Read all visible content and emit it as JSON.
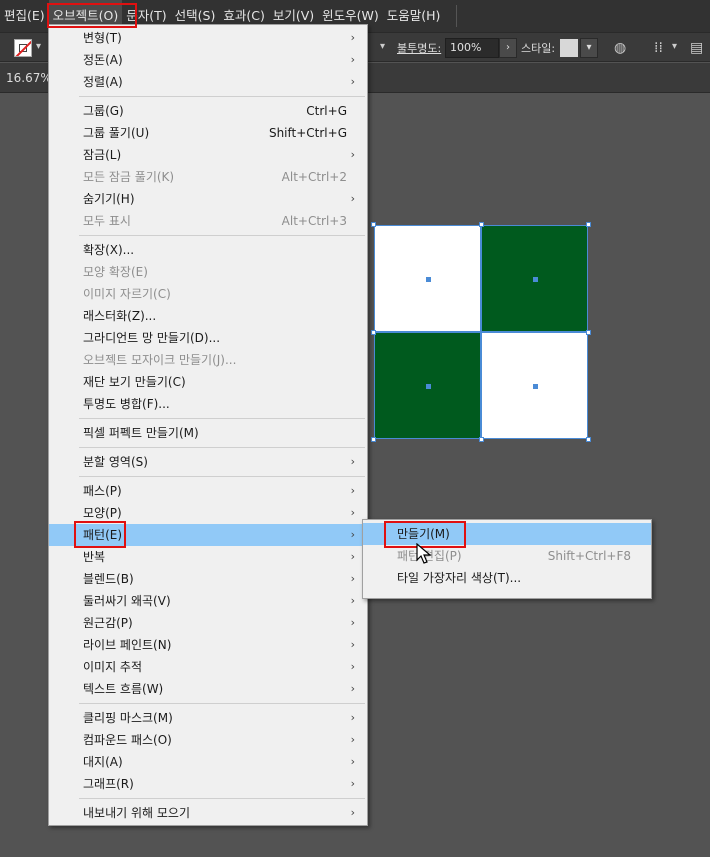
{
  "menubar": {
    "items": [
      "편집(E)",
      "오브젝트(O)",
      "문자(T)",
      "선택(S)",
      "효과(C)",
      "보기(V)",
      "윈도우(W)",
      "도움말(H)"
    ]
  },
  "toolbar": {
    "opacity_label": "불투명도:",
    "opacity_value": "100%",
    "style_label": "스타일:"
  },
  "document": {
    "zoom": "16.67%"
  },
  "colors": {
    "accent": "#91c9f7",
    "green": "#005a1e",
    "selection": "#4a8bd6",
    "highlight_red": "#e01010"
  },
  "object_menu": {
    "items": [
      {
        "label": "변형(T)",
        "shortcut": "",
        "submenu": true,
        "disabled": false
      },
      {
        "label": "정돈(A)",
        "shortcut": "",
        "submenu": true,
        "disabled": false
      },
      {
        "label": "정렬(A)",
        "shortcut": "",
        "submenu": true,
        "disabled": false
      },
      {
        "sep": true
      },
      {
        "label": "그룹(G)",
        "shortcut": "Ctrl+G",
        "submenu": false,
        "disabled": false
      },
      {
        "label": "그룹 풀기(U)",
        "shortcut": "Shift+Ctrl+G",
        "submenu": false,
        "disabled": false
      },
      {
        "label": "잠금(L)",
        "shortcut": "",
        "submenu": true,
        "disabled": false
      },
      {
        "label": "모든 잠금 풀기(K)",
        "shortcut": "Alt+Ctrl+2",
        "submenu": false,
        "disabled": true
      },
      {
        "label": "숨기기(H)",
        "shortcut": "",
        "submenu": true,
        "disabled": false
      },
      {
        "label": "모두 표시",
        "shortcut": "Alt+Ctrl+3",
        "submenu": false,
        "disabled": true
      },
      {
        "sep": true
      },
      {
        "label": "확장(X)...",
        "shortcut": "",
        "submenu": false,
        "disabled": false
      },
      {
        "label": "모양 확장(E)",
        "shortcut": "",
        "submenu": false,
        "disabled": true
      },
      {
        "label": "이미지 자르기(C)",
        "shortcut": "",
        "submenu": false,
        "disabled": true
      },
      {
        "label": "래스터화(Z)...",
        "shortcut": "",
        "submenu": false,
        "disabled": false
      },
      {
        "label": "그라디언트 망 만들기(D)...",
        "shortcut": "",
        "submenu": false,
        "disabled": false
      },
      {
        "label": "오브젝트 모자이크 만들기(J)...",
        "shortcut": "",
        "submenu": false,
        "disabled": true
      },
      {
        "label": "재단 보기 만들기(C)",
        "shortcut": "",
        "submenu": false,
        "disabled": false
      },
      {
        "label": "투명도 병합(F)...",
        "shortcut": "",
        "submenu": false,
        "disabled": false
      },
      {
        "sep": true
      },
      {
        "label": "픽셀 퍼펙트 만들기(M)",
        "shortcut": "",
        "submenu": false,
        "disabled": false
      },
      {
        "sep": true
      },
      {
        "label": "분할 영역(S)",
        "shortcut": "",
        "submenu": true,
        "disabled": false
      },
      {
        "sep": true
      },
      {
        "label": "패스(P)",
        "shortcut": "",
        "submenu": true,
        "disabled": false
      },
      {
        "label": "모양(P)",
        "shortcut": "",
        "submenu": true,
        "disabled": false
      },
      {
        "label": "패턴(E)",
        "shortcut": "",
        "submenu": true,
        "disabled": false,
        "highlighted": true
      },
      {
        "label": "반복",
        "shortcut": "",
        "submenu": true,
        "disabled": false
      },
      {
        "label": "블렌드(B)",
        "shortcut": "",
        "submenu": true,
        "disabled": false
      },
      {
        "label": "둘러싸기 왜곡(V)",
        "shortcut": "",
        "submenu": true,
        "disabled": false
      },
      {
        "label": "원근감(P)",
        "shortcut": "",
        "submenu": true,
        "disabled": false
      },
      {
        "label": "라이브 페인트(N)",
        "shortcut": "",
        "submenu": true,
        "disabled": false
      },
      {
        "label": "이미지 추적",
        "shortcut": "",
        "submenu": true,
        "disabled": false
      },
      {
        "label": "텍스트 흐름(W)",
        "shortcut": "",
        "submenu": true,
        "disabled": false
      },
      {
        "sep": true
      },
      {
        "label": "클리핑 마스크(M)",
        "shortcut": "",
        "submenu": true,
        "disabled": false
      },
      {
        "label": "컴파운드 패스(O)",
        "shortcut": "",
        "submenu": true,
        "disabled": false
      },
      {
        "label": "대지(A)",
        "shortcut": "",
        "submenu": true,
        "disabled": false
      },
      {
        "label": "그래프(R)",
        "shortcut": "",
        "submenu": true,
        "disabled": false
      },
      {
        "sep": true
      },
      {
        "label": "내보내기 위해 모으기",
        "shortcut": "",
        "submenu": true,
        "disabled": false
      }
    ]
  },
  "pattern_submenu": {
    "items": [
      {
        "label": "만들기(M)",
        "shortcut": "",
        "disabled": false,
        "highlighted": true
      },
      {
        "label": "패턴 편집(P)",
        "shortcut": "Shift+Ctrl+F8",
        "disabled": true
      },
      {
        "label": "타일 가장자리 색상(T)...",
        "shortcut": "",
        "disabled": false
      }
    ]
  }
}
